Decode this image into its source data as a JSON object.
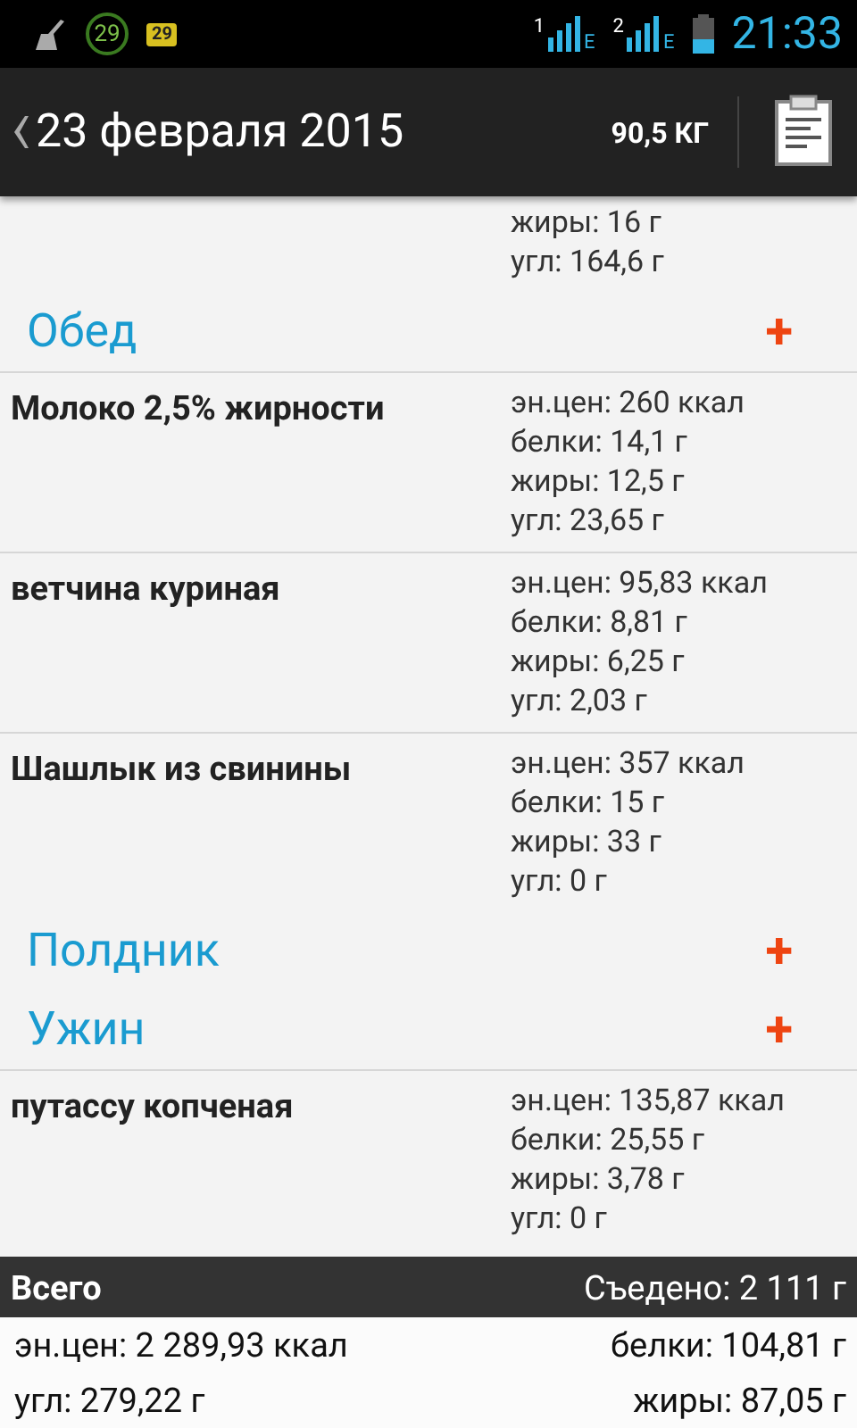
{
  "status_bar": {
    "notification_badge": "29",
    "battery_notification": "29",
    "sims": [
      {
        "slot": "1",
        "network": "E"
      },
      {
        "slot": "2",
        "network": "E"
      }
    ],
    "time": "21:33"
  },
  "header": {
    "title": "23 февраля 2015",
    "weight": "90,5 КГ"
  },
  "list": [
    {
      "kind": "food",
      "values": [
        "жиры: 16 г",
        "угл: 164,6 г"
      ]
    },
    {
      "kind": "meal",
      "title": "Обед",
      "add": "+"
    },
    {
      "kind": "food",
      "name": "Молоко 2,5% жирности",
      "values": [
        "эн.цен: 260 ккал",
        "белки: 14,1 г",
        "жиры: 12,5 г",
        "угл: 23,65 г"
      ]
    },
    {
      "kind": "food",
      "name": "ветчина куриная",
      "values": [
        "эн.цен: 95,83 ккал",
        "белки: 8,81 г",
        "жиры: 6,25 г",
        "угл: 2,03 г"
      ]
    },
    {
      "kind": "food",
      "name": "Шашлык из свинины",
      "values": [
        "эн.цен: 357 ккал",
        "белки: 15 г",
        "жиры: 33 г",
        "угл: 0 г"
      ]
    },
    {
      "kind": "meal",
      "title": "Полдник",
      "add": "+"
    },
    {
      "kind": "meal",
      "title": "Ужин",
      "add": "+"
    },
    {
      "kind": "food",
      "name": "путассу копченая",
      "values": [
        "эн.цен: 135,87 ккал",
        "белки: 25,55 г",
        "жиры: 3,78 г",
        "угл: 0 г"
      ]
    }
  ],
  "totals": {
    "title": "Всего",
    "eaten": "Съедено: 2 111 г",
    "energy": "эн.цен: 2 289,93 ккал",
    "protein": "белки: 104,81 г",
    "carbs": "угл: 279,22 г",
    "fat": "жиры: 87,05 г"
  }
}
